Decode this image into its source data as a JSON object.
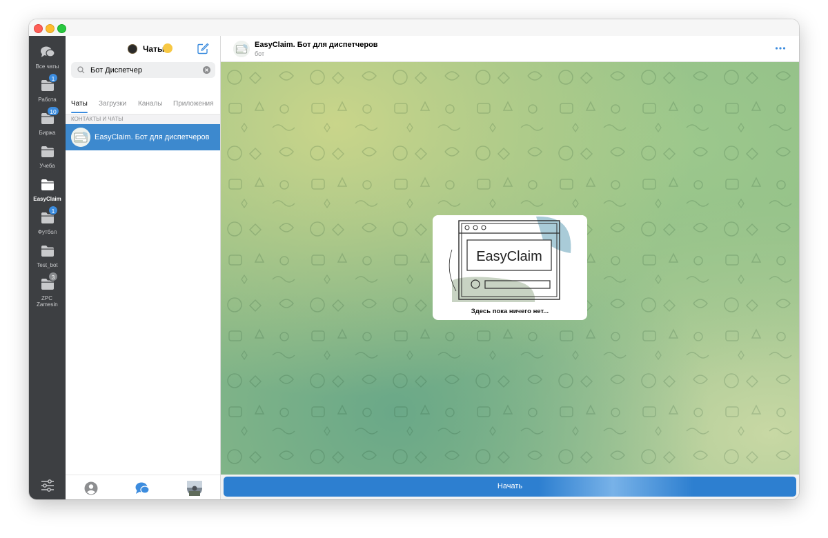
{
  "folders": [
    {
      "label": "Все чаты",
      "icon": "chats-icon",
      "badge": ""
    },
    {
      "label": "Работа",
      "icon": "folder-icon",
      "badge": "1"
    },
    {
      "label": "Биржа",
      "icon": "folder-icon",
      "badge": "10"
    },
    {
      "label": "Учеба",
      "icon": "folder-icon",
      "badge": ""
    },
    {
      "label": "EasyClaim",
      "icon": "folder-icon",
      "badge": "",
      "active": true
    },
    {
      "label": "Футбол",
      "icon": "folder-icon",
      "badge": "1"
    },
    {
      "label": "Test_bot",
      "icon": "folder-icon",
      "badge": ""
    },
    {
      "label": "ZPC Zamesin",
      "icon": "folder-icon",
      "badge": "3",
      "badge_muted": true
    }
  ],
  "left_panel": {
    "title": "Чаты",
    "search": {
      "value": "Бот Диспетчер",
      "placeholder": "Поиск"
    },
    "tabs": [
      {
        "label": "Чаты",
        "active": true
      },
      {
        "label": "Загрузки"
      },
      {
        "label": "Каналы"
      },
      {
        "label": "Приложения"
      }
    ],
    "section_header": "КОНТАКТЫ И ЧАТЫ",
    "results": [
      {
        "name": "EasyClaim. Бот для диспетчеров"
      }
    ]
  },
  "chat": {
    "title": "EasyClaim. Бот для диспетчеров",
    "subtitle": "бот",
    "welcome_logo_text": "EasyClaim",
    "welcome_text": "Здесь пока ничего нет...",
    "start_button": "Начать"
  },
  "colors": {
    "accent": "#3c8cde",
    "selected_row": "#3d89ce",
    "rail_bg": "#3d3f42"
  }
}
